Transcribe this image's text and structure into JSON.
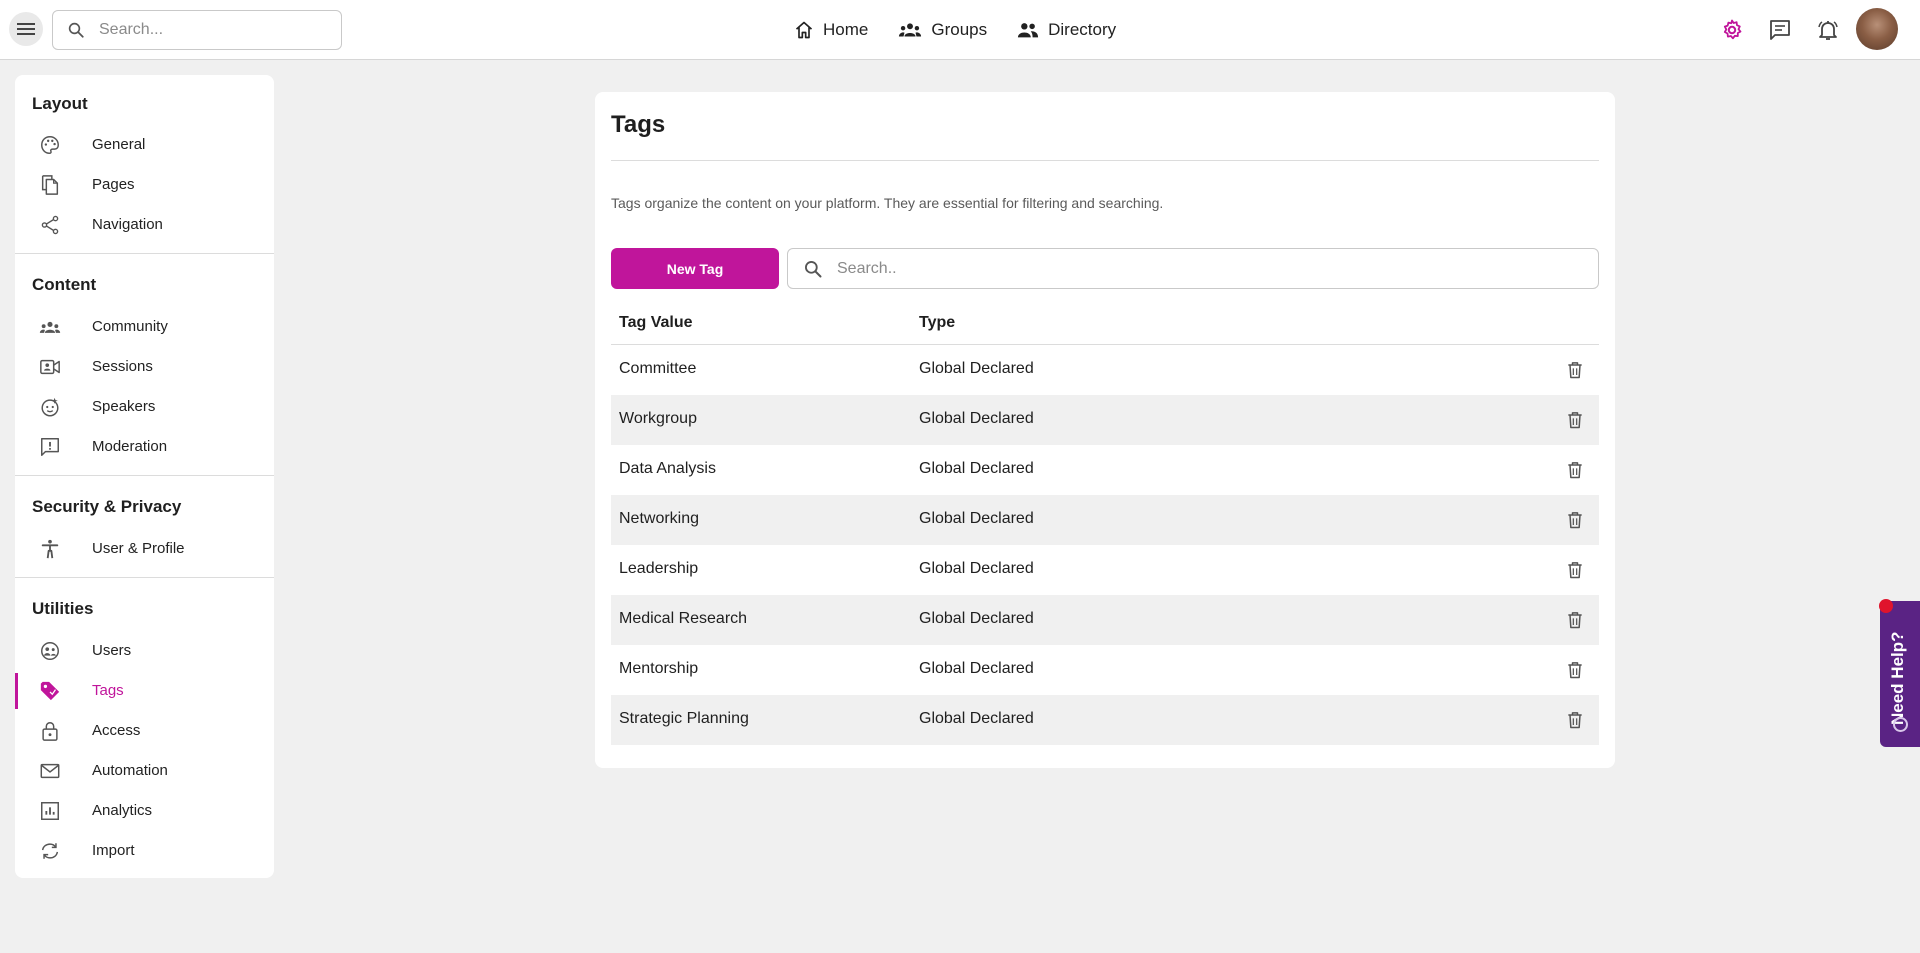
{
  "topbar": {
    "search_placeholder": "Search...",
    "nav": [
      {
        "label": "Home",
        "icon": "home-icon"
      },
      {
        "label": "Groups",
        "icon": "groups-icon"
      },
      {
        "label": "Directory",
        "icon": "directory-icon"
      }
    ],
    "accent_color": "#c0159b"
  },
  "sidebar": {
    "sections": [
      {
        "title": "Layout",
        "items": [
          {
            "label": "General",
            "icon": "palette-icon"
          },
          {
            "label": "Pages",
            "icon": "pages-icon"
          },
          {
            "label": "Navigation",
            "icon": "share-icon"
          }
        ]
      },
      {
        "title": "Content",
        "items": [
          {
            "label": "Community",
            "icon": "community-icon"
          },
          {
            "label": "Sessions",
            "icon": "video-icon"
          },
          {
            "label": "Speakers",
            "icon": "face-icon"
          },
          {
            "label": "Moderation",
            "icon": "report-icon"
          }
        ]
      },
      {
        "title": "Security & Privacy",
        "items": [
          {
            "label": "User & Profile",
            "icon": "accessibility-icon"
          }
        ]
      },
      {
        "title": "Utilities",
        "items": [
          {
            "label": "Users",
            "icon": "users-icon"
          },
          {
            "label": "Tags",
            "icon": "tag-icon",
            "active": true
          },
          {
            "label": "Access",
            "icon": "lock-icon"
          },
          {
            "label": "Automation",
            "icon": "mail-icon"
          },
          {
            "label": "Analytics",
            "icon": "analytics-icon"
          },
          {
            "label": "Import",
            "icon": "sync-icon"
          }
        ]
      }
    ]
  },
  "main": {
    "title": "Tags",
    "description": "Tags organize the content on your platform. They are essential for filtering and searching.",
    "new_button": "New Tag",
    "search_placeholder": "Search..",
    "columns": [
      "Tag Value",
      "Type"
    ],
    "rows": [
      {
        "value": "Committee",
        "type": "Global Declared"
      },
      {
        "value": "Workgroup",
        "type": "Global Declared"
      },
      {
        "value": "Data Analysis",
        "type": "Global Declared"
      },
      {
        "value": "Networking",
        "type": "Global Declared"
      },
      {
        "value": "Leadership",
        "type": "Global Declared"
      },
      {
        "value": "Medical Research",
        "type": "Global Declared"
      },
      {
        "value": "Mentorship",
        "type": "Global Declared"
      },
      {
        "value": "Strategic Planning",
        "type": "Global Declared"
      }
    ]
  },
  "help_widget": {
    "label": "Need Help?",
    "color": "#5a2384"
  }
}
